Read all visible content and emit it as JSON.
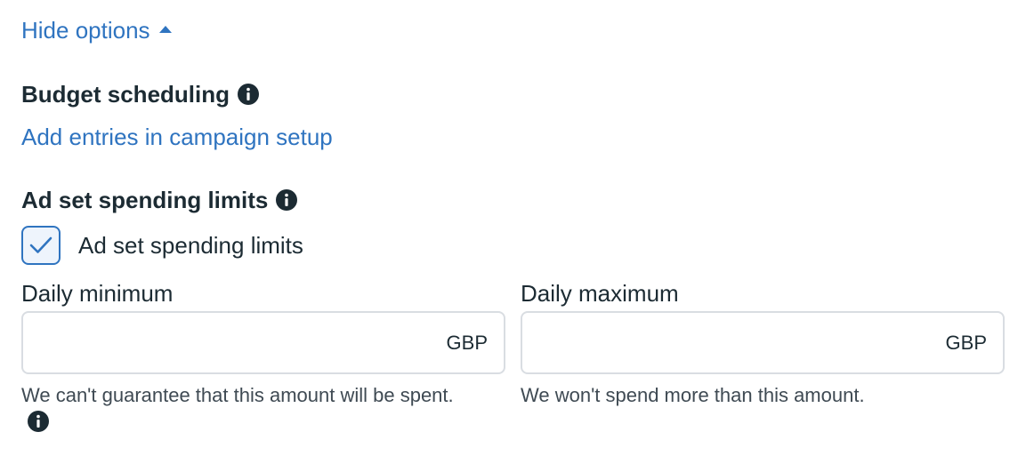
{
  "options_toggle": {
    "label": "Hide options"
  },
  "budget_scheduling": {
    "title": "Budget scheduling",
    "link": "Add entries in campaign setup"
  },
  "spending_limits": {
    "title": "Ad set spending limits",
    "checkbox_label": "Ad set spending limits",
    "checkbox_checked": true
  },
  "daily_minimum": {
    "label": "Daily minimum",
    "value": "",
    "currency": "GBP",
    "helper": "We can't guarantee that this amount will be spent."
  },
  "daily_maximum": {
    "label": "Daily maximum",
    "value": "",
    "currency": "GBP",
    "helper": "We won't spend more than this amount."
  },
  "colors": {
    "link": "#2f74c0",
    "text": "#1c2b33",
    "border": "#d9dde2"
  },
  "icons": [
    "caret-up-icon",
    "info-icon",
    "checkmark-icon"
  ]
}
